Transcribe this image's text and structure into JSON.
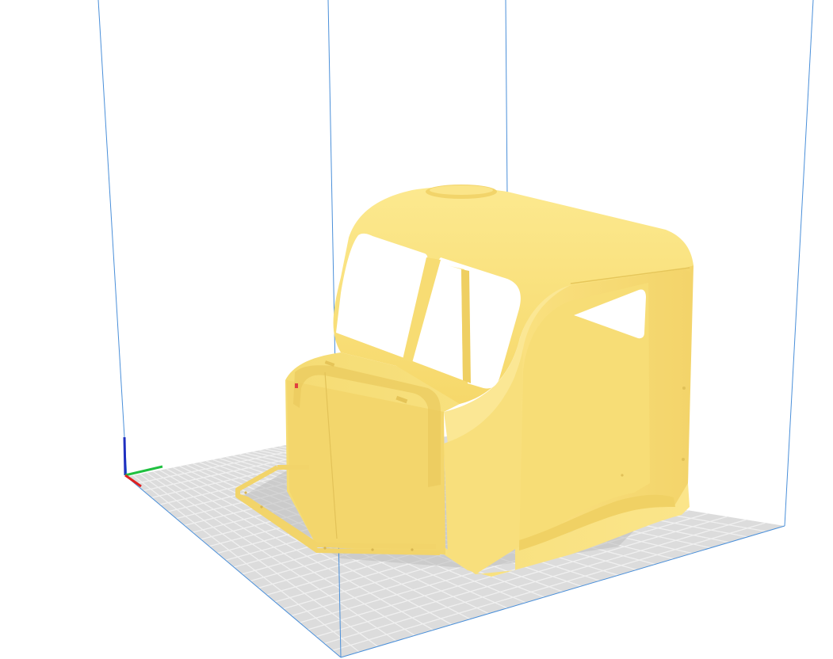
{
  "scene": {
    "background": "#ffffff",
    "build_plate_color": "#dcdcdc",
    "build_plate_grid_color": "#f0f0f0",
    "build_volume_edge_color": "#4a8fd9",
    "model_color": "#fbe37e",
    "model_shadow_color": "#c9b25a",
    "axis_colors": {
      "x": "#e02020",
      "y": "#20c040",
      "z": "#2030c0"
    },
    "model": {
      "name_icon": "truck-cab-model",
      "selected": false
    }
  }
}
